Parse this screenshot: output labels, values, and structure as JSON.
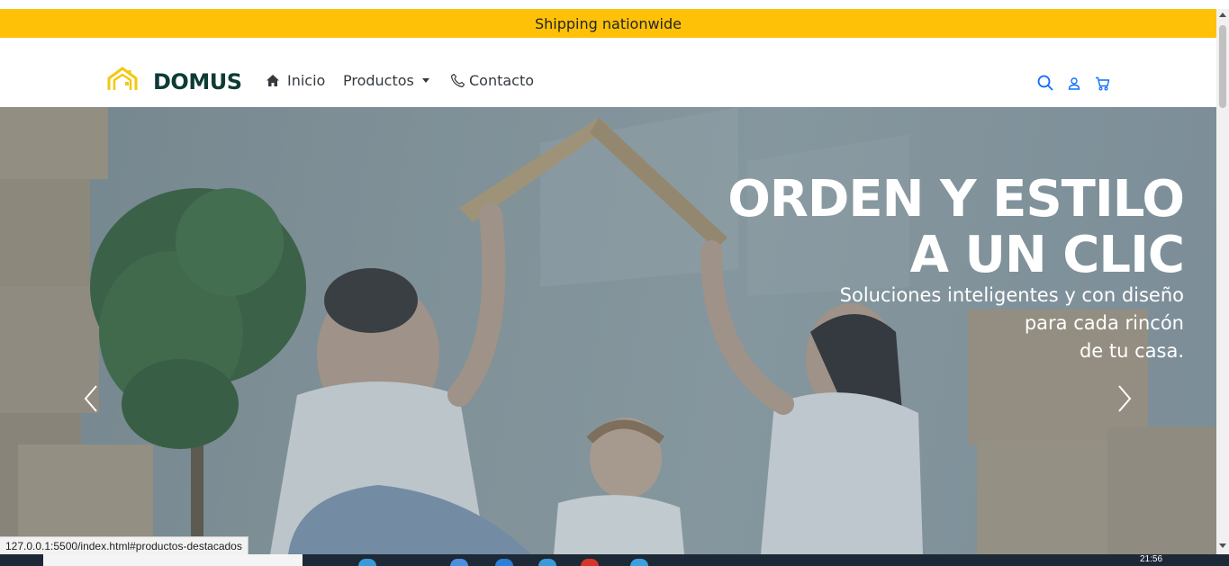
{
  "promo": {
    "text": "Shipping nationwide"
  },
  "brand": {
    "name": "DOMUS",
    "logo_color": "#f2c811",
    "text_color": "#0e3b35"
  },
  "nav": {
    "items": [
      {
        "label": "Inicio",
        "icon": "home-icon"
      },
      {
        "label": "Productos",
        "icon": "chevron-down-icon"
      },
      {
        "label": "Contacto",
        "icon": "phone-icon"
      }
    ],
    "actions": [
      {
        "icon": "search-icon"
      },
      {
        "icon": "user-icon"
      },
      {
        "icon": "cart-icon"
      }
    ],
    "action_color": "#0d6efd"
  },
  "hero": {
    "title_line1": "ORDEN Y ESTILO",
    "title_line2": "A UN CLIC",
    "subtitle_line1": "Soluciones inteligentes y con diseño",
    "subtitle_line2": "para cada rincón",
    "subtitle_line3": "de tu casa.",
    "prev_icon": "chevron-left-icon",
    "next_icon": "chevron-right-icon"
  },
  "status_bar": {
    "url": "127.0.0.1:5500/index.html#productos-destacados"
  },
  "taskbar": {
    "clock": "21:56"
  },
  "colors": {
    "promo_bg": "#ffc107",
    "link_color": "#0d6efd"
  }
}
